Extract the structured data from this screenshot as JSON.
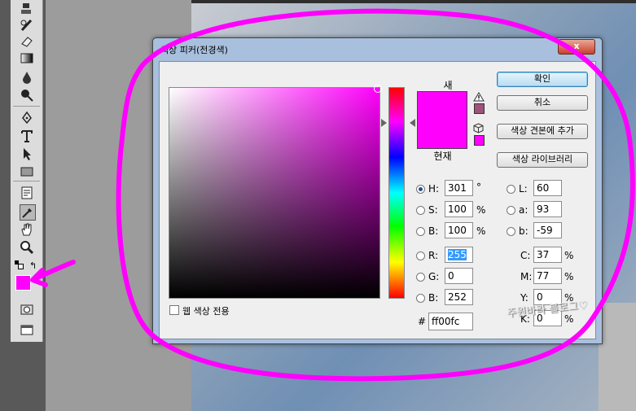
{
  "dialog": {
    "title": "색상 피커(전경색)",
    "close_glyph": "x",
    "new_label": "새",
    "current_label": "현재",
    "buttons": {
      "ok": "확인",
      "cancel": "취소",
      "add_to_swatches": "색상 견본에 추가",
      "color_libraries": "색상 라이브러리"
    },
    "web_only_label": "웹 색상 전용",
    "fields": {
      "H": {
        "label": "H:",
        "value": "301",
        "unit": "°"
      },
      "S": {
        "label": "S:",
        "value": "100",
        "unit": "%"
      },
      "Bv": {
        "label": "B:",
        "value": "100",
        "unit": "%"
      },
      "R": {
        "label": "R:",
        "value": "255"
      },
      "G": {
        "label": "G:",
        "value": "0"
      },
      "Bc": {
        "label": "B:",
        "value": "252"
      },
      "L": {
        "label": "L:",
        "value": "60"
      },
      "a": {
        "label": "a:",
        "value": "93"
      },
      "b": {
        "label": "b:",
        "value": "-59"
      },
      "C": {
        "label": "C:",
        "value": "37",
        "unit": "%"
      },
      "M": {
        "label": "M:",
        "value": "77",
        "unit": "%"
      },
      "Y": {
        "label": "Y:",
        "value": "0",
        "unit": "%"
      },
      "K": {
        "label": "K:",
        "value": "0",
        "unit": "%"
      }
    },
    "hex_label": "#",
    "hex_value": "ff00fc"
  },
  "colors": {
    "foreground": "#ff00fc",
    "annotation": "#ff00ff",
    "gamut_swatch": "#a0527c"
  },
  "toolbox": {
    "icons": [
      "stamp-icon",
      "history-brush-icon",
      "eraser-icon",
      "gradient-icon",
      "blur-icon",
      "dodge-icon",
      "pen-icon",
      "type-icon",
      "path-select-icon",
      "shape-icon",
      "notes-icon",
      "eyedropper-icon",
      "hand-icon",
      "zoom-icon",
      "quick-mask-icon",
      "screen-mode-icon"
    ]
  },
  "watermark": "주원바라 블로그♡"
}
